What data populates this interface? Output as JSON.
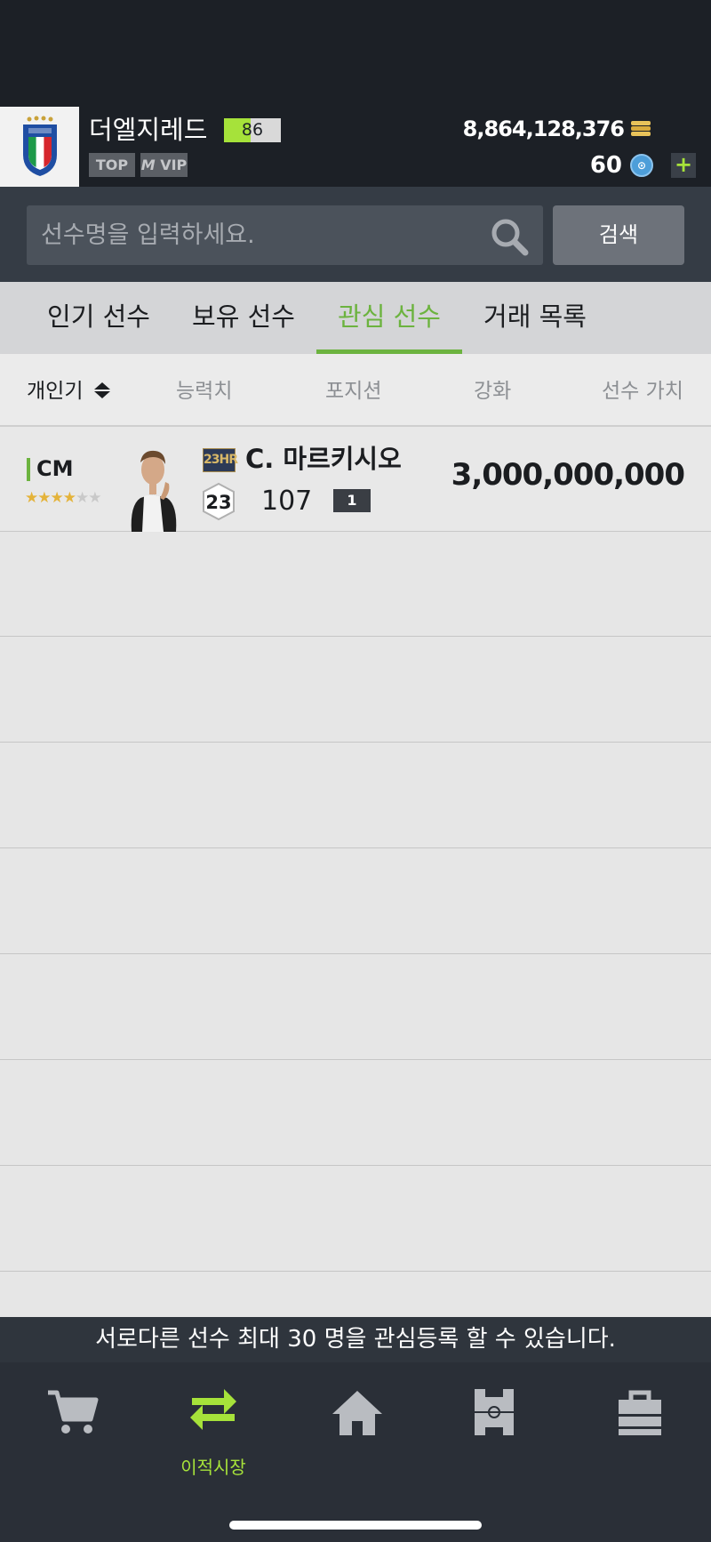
{
  "profile": {
    "manager_name": "더엘지레드",
    "level": "86",
    "level_progress": 0.47,
    "tags": [
      "TOP",
      "VIP"
    ],
    "bp_amount": "8,864,128,376",
    "fc_amount": "60",
    "plus_label": "+"
  },
  "search": {
    "placeholder": "선수명을 입력하세요.",
    "button_label": "검색"
  },
  "tabs": [
    {
      "label": "인기 선수",
      "active": false
    },
    {
      "label": "보유 선수",
      "active": false
    },
    {
      "label": "관심 선수",
      "active": true
    },
    {
      "label": "거래 목록",
      "active": false
    }
  ],
  "sort_columns": [
    "개인기",
    "능력치",
    "포지션",
    "강화",
    "선수 가치"
  ],
  "players": [
    {
      "position": "CM",
      "skill_stars": 4,
      "skill_stars_max": 6,
      "season": "23HR",
      "name": "C. 마르키시오",
      "hex_value": "23",
      "ovr": "107",
      "grade": "1",
      "price": "3,000,000,000"
    }
  ],
  "notice": "서로다른 선수 최대 30 명을 관심등록 할 수 있습니다.",
  "bottom_nav": [
    {
      "icon": "cart-icon",
      "label": ""
    },
    {
      "icon": "transfer-arrows-icon",
      "label": "이적시장",
      "active": true
    },
    {
      "icon": "home-icon",
      "label": ""
    },
    {
      "icon": "squad-field-icon",
      "label": ""
    },
    {
      "icon": "locker-icon",
      "label": ""
    }
  ],
  "colors": {
    "accent_green": "#6cb33f",
    "level_green": "#a6e23a",
    "dark_bg": "#1c2026"
  }
}
